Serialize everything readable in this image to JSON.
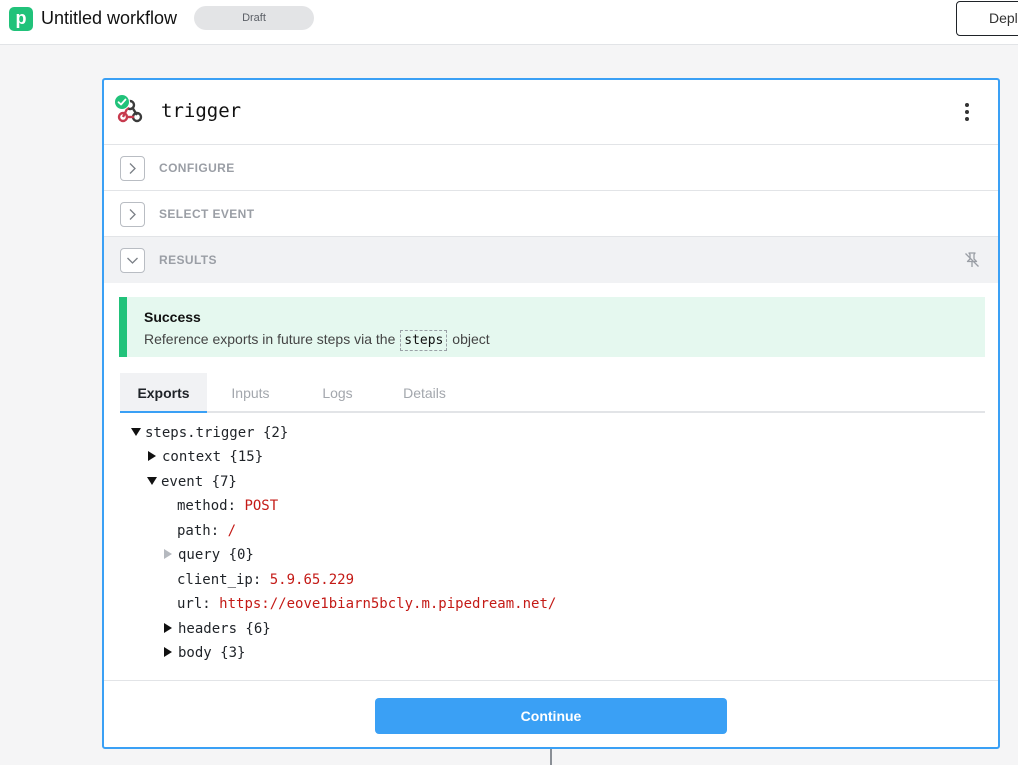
{
  "header": {
    "logo_letter": "p",
    "workflow_title": "Untitled workflow",
    "status": "Draft",
    "deploy_label": "Depl"
  },
  "step": {
    "name": "trigger",
    "icons": {
      "trigger": "webhook-icon",
      "status": "check-circle-icon",
      "menu": "kebab-menu-icon"
    },
    "sections": [
      {
        "label": "CONFIGURE",
        "expanded": false
      },
      {
        "label": "SELECT EVENT",
        "expanded": false
      },
      {
        "label": "RESULTS",
        "expanded": true
      }
    ],
    "results": {
      "alert_title": "Success",
      "alert_text_before": "Reference exports in future steps via the",
      "alert_code": "steps",
      "alert_text_after": "object",
      "tabs": [
        "Exports",
        "Inputs",
        "Logs",
        "Details"
      ],
      "active_tab": "Exports",
      "tree": {
        "root": "steps.trigger {2}",
        "context": "context {15}",
        "event": "event {7}",
        "method_key": "method:",
        "method_val": "POST",
        "path_key": "path:",
        "path_val": "/",
        "query": "query {0}",
        "client_ip_key": "client_ip:",
        "client_ip_val": "5.9.65.229",
        "url_key": "url:",
        "url_val": "https://eove1biarn5bcly.m.pipedream.net/",
        "headers": "headers {6}",
        "body": "body {3}"
      }
    },
    "continue_label": "Continue"
  },
  "colors": {
    "accent": "#3aa0f5",
    "brand": "#21c27a",
    "value_red": "#c41a16",
    "success_bg": "#e5f8ef"
  }
}
